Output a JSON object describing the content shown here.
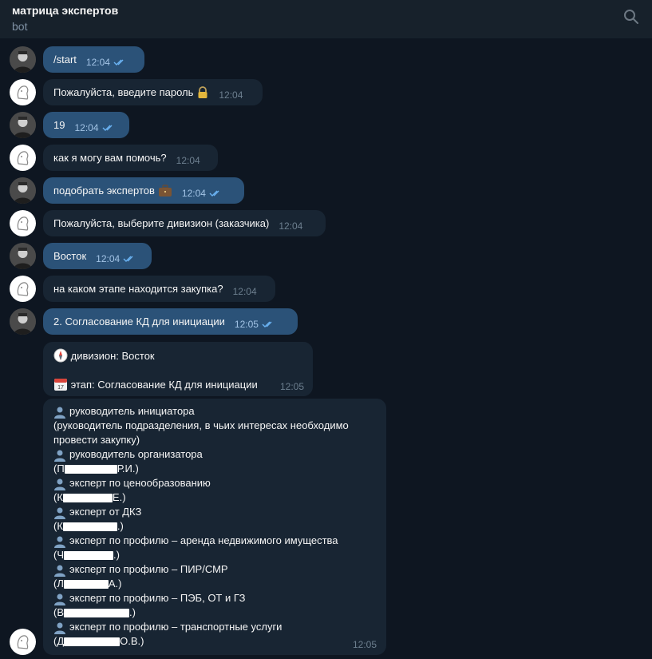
{
  "header": {
    "title": "матрица экспертов",
    "subtitle": "bot",
    "search_icon": "search-icon"
  },
  "messages": [
    {
      "from": "user",
      "text": "/start",
      "time": "12:04"
    },
    {
      "from": "bot",
      "text": "Пожалуйста, введите пароль",
      "emoji": "lock-icon",
      "time": "12:04"
    },
    {
      "from": "user",
      "text": "19",
      "time": "12:04"
    },
    {
      "from": "bot",
      "text": "как я могу вам помочь?",
      "time": "12:04"
    },
    {
      "from": "user",
      "text": "подобрать экспертов",
      "emoji": "briefcase-icon",
      "time": "12:04"
    },
    {
      "from": "bot",
      "text": "Пожалуйста, выберите дивизион (заказчика)",
      "time": "12:04"
    },
    {
      "from": "user",
      "text": "Восток",
      "time": "12:04"
    },
    {
      "from": "bot",
      "text": "на каком этапе находится закупка?",
      "time": "12:04"
    },
    {
      "from": "user",
      "text": "2. Согласование КД для инициации",
      "time": "12:05"
    }
  ],
  "summary": {
    "division": "дивизион: Восток",
    "stage": "этап: Согласование КД для инициации",
    "time": "12:05"
  },
  "experts": {
    "time": "12:05",
    "lines": [
      "руководитель инициатора",
      "(руководитель подразделения, в чьих интересах необходимо",
      "провести закупку)",
      "руководитель организатора",
      "(П",
      "Р.И.)",
      "эксперт по ценообразованию",
      "(К",
      "Е.)",
      "эксперт от ДКЗ",
      "(К",
      ".)",
      "эксперт по профилю – аренда недвижимого имущества",
      "(Ч",
      ".)",
      "эксперт по профилю – ПИР/СМР",
      "(Л",
      "А.)",
      "эксперт по профилю – ПЭБ, ОТ и ГЗ",
      "(В",
      ".)",
      "эксперт по профилю – транспортные услуги",
      "(Д",
      "О.В.)"
    ]
  },
  "colors": {
    "bg": "#0e1621",
    "header": "#17212b",
    "out_bubble": "#2b5278",
    "in_bubble": "#182533",
    "accent": "#6ab2f2"
  }
}
